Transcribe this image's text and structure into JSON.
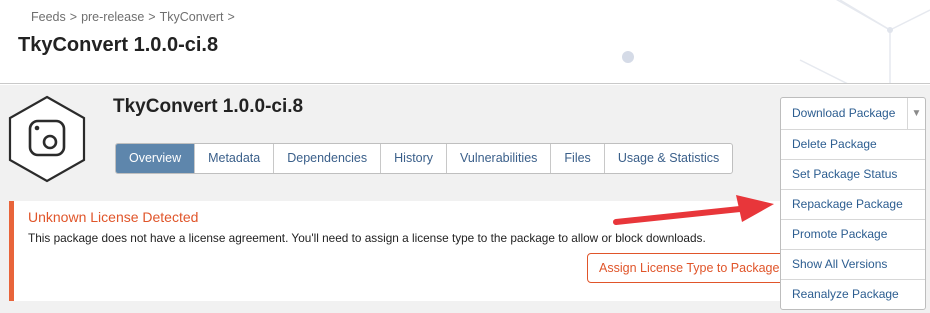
{
  "breadcrumb": {
    "feeds": "Feeds",
    "feed": "pre-release",
    "package": "TkyConvert",
    "sep": ">"
  },
  "page_title": "TkyConvert 1.0.0-ci.8",
  "package": {
    "title": "TkyConvert 1.0.0-ci.8",
    "icon": "package-hexagon-icon"
  },
  "tabs": [
    {
      "label": "Overview",
      "active": true
    },
    {
      "label": "Metadata"
    },
    {
      "label": "Dependencies"
    },
    {
      "label": "History"
    },
    {
      "label": "Vulnerabilities"
    },
    {
      "label": "Files"
    },
    {
      "label": "Usage & Statistics"
    }
  ],
  "alert": {
    "title": "Unknown License Detected",
    "text": "This package does not have a license agreement. You'll need to assign a license type to the package to allow or block downloads.",
    "button": "Assign License Type to Package"
  },
  "actions": {
    "download": "Download Package",
    "caret": "▼",
    "items": [
      "Delete Package",
      "Set Package Status",
      "Repackage Package",
      "Promote Package",
      "Show All Versions",
      "Reanalyze Package"
    ]
  },
  "colors": {
    "accent": "#e0552a",
    "tab_active": "#5e86ac",
    "link": "#2c5d90",
    "arrow": "#e8363a"
  }
}
